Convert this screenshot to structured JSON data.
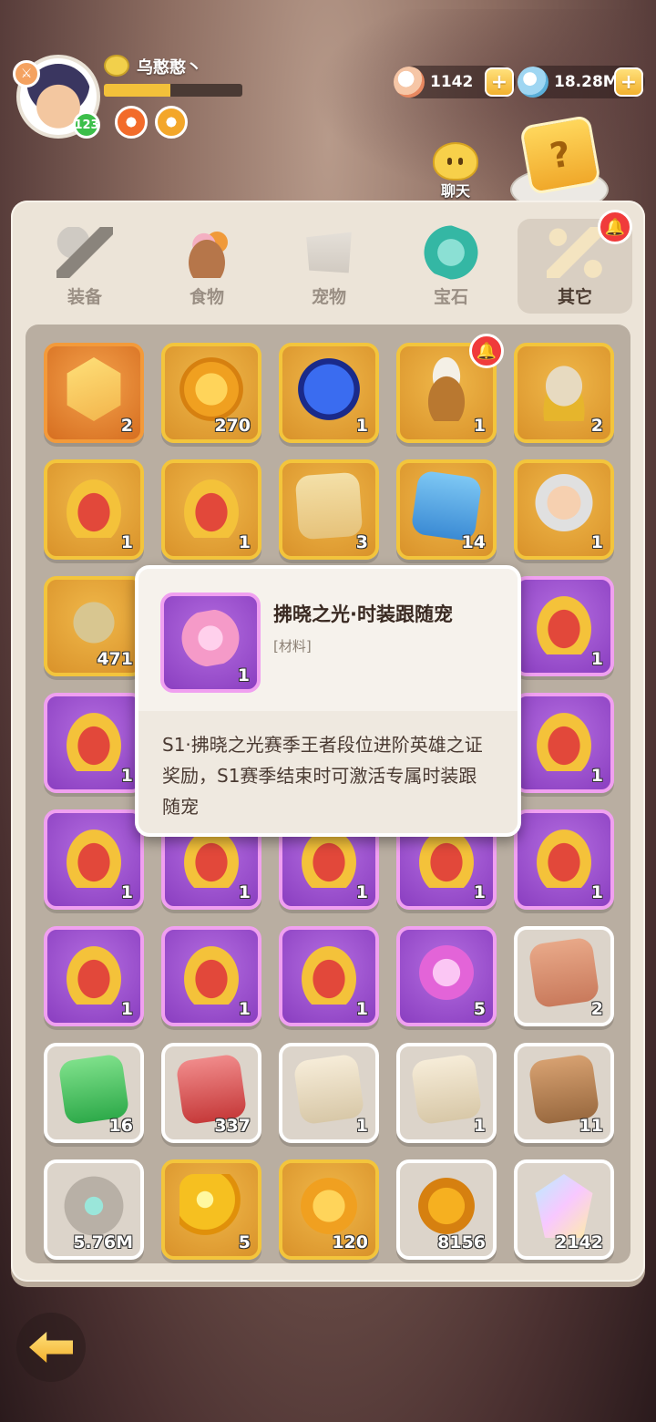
{
  "player": {
    "name": "乌憨憨丶",
    "level": "123",
    "exp_fraction": 0.48,
    "icons": [
      "sword-icon",
      "rank-smile-icon",
      "buff-fire-icon",
      "buff-swirl-icon"
    ]
  },
  "currencies": [
    {
      "name": "shell",
      "value": "1142",
      "icon": "shell-icon"
    },
    {
      "name": "diamond",
      "value": "18.28M",
      "icon": "diamond-icon"
    }
  ],
  "chat": {
    "label": "聊天"
  },
  "tabs": [
    {
      "label": "装备",
      "icon": "hammer-icon",
      "active": false
    },
    {
      "label": "食物",
      "icon": "food-icon",
      "active": false
    },
    {
      "label": "宠物",
      "icon": "pet-icon",
      "active": false
    },
    {
      "label": "宝石",
      "icon": "gem-icon",
      "active": false
    },
    {
      "label": "其它",
      "icon": "bone-icon",
      "active": true
    }
  ],
  "inventory": [
    {
      "icon": "crystal-pet-icon",
      "count": "2",
      "rarity": "orange"
    },
    {
      "icon": "spiral-coin-icon",
      "count": "270",
      "rarity": "gold"
    },
    {
      "icon": "skill-icon",
      "count": "1",
      "rarity": "gold"
    },
    {
      "icon": "horn-chest-icon",
      "count": "1",
      "rarity": "gold",
      "alert": true
    },
    {
      "icon": "egg-icon",
      "count": "2",
      "rarity": "gold"
    },
    {
      "icon": "treasure-chest-icon",
      "count": "1",
      "rarity": "gold"
    },
    {
      "icon": "treasure-chest-icon",
      "count": "1",
      "rarity": "gold"
    },
    {
      "icon": "blueprint-icon",
      "count": "3",
      "rarity": "gold"
    },
    {
      "icon": "blue-ticket-icon",
      "count": "14",
      "rarity": "gold"
    },
    {
      "icon": "hero-card-icon",
      "count": "1",
      "rarity": "gold"
    },
    {
      "icon": "statue-icon",
      "count": "471",
      "rarity": "gold"
    },
    {
      "icon": "treasure-chest-icon",
      "count": "",
      "rarity": "purple"
    },
    {
      "icon": "treasure-chest-icon",
      "count": "",
      "rarity": "purple"
    },
    {
      "icon": "treasure-chest-icon",
      "count": "",
      "rarity": "purple"
    },
    {
      "icon": "treasure-chest-icon",
      "count": "1",
      "rarity": "purple"
    },
    {
      "icon": "treasure-chest-icon",
      "count": "1",
      "rarity": "purple"
    },
    {
      "icon": "treasure-chest-icon",
      "count": "",
      "rarity": "purple"
    },
    {
      "icon": "treasure-chest-icon",
      "count": "",
      "rarity": "purple"
    },
    {
      "icon": "treasure-chest-icon",
      "count": "",
      "rarity": "purple"
    },
    {
      "icon": "treasure-chest-icon",
      "count": "1",
      "rarity": "purple"
    },
    {
      "icon": "treasure-chest-icon",
      "count": "1",
      "rarity": "purple"
    },
    {
      "icon": "treasure-chest-icon",
      "count": "1",
      "rarity": "purple"
    },
    {
      "icon": "treasure-chest-icon",
      "count": "1",
      "rarity": "purple"
    },
    {
      "icon": "treasure-chest-icon",
      "count": "1",
      "rarity": "purple"
    },
    {
      "icon": "treasure-chest-icon",
      "count": "1",
      "rarity": "purple"
    },
    {
      "icon": "treasure-chest-icon",
      "count": "1",
      "rarity": "purple"
    },
    {
      "icon": "treasure-chest-icon",
      "count": "1",
      "rarity": "purple"
    },
    {
      "icon": "treasure-chest-icon",
      "count": "1",
      "rarity": "purple"
    },
    {
      "icon": "pink-gem-icon",
      "count": "5",
      "rarity": "purple"
    },
    {
      "icon": "paw-scroll-icon",
      "count": "2",
      "rarity": "white"
    },
    {
      "icon": "green-scroll-icon",
      "count": "16",
      "rarity": "white"
    },
    {
      "icon": "red-scroll-icon",
      "count": "337",
      "rarity": "white"
    },
    {
      "icon": "beige-scroll-icon",
      "count": "1",
      "rarity": "white"
    },
    {
      "icon": "beige-scroll-icon",
      "count": "1",
      "rarity": "white"
    },
    {
      "icon": "brown-scroll-icon",
      "count": "11",
      "rarity": "white"
    },
    {
      "icon": "rune-stone-icon",
      "count": "5.76M",
      "rarity": "white"
    },
    {
      "icon": "golden-orb-icon",
      "count": "5",
      "rarity": "gold"
    },
    {
      "icon": "rune-coin-icon",
      "count": "120",
      "rarity": "gold"
    },
    {
      "icon": "char-coin-icon",
      "count": "8156",
      "rarity": "white"
    },
    {
      "icon": "rainbow-crystal-icon",
      "count": "2142",
      "rarity": "white"
    }
  ],
  "tooltip": {
    "title": "拂晓之光·时装跟随宠",
    "type": "[材料]",
    "count": "1",
    "description": "S1·拂晓之光赛季王者段位进阶英雄之证奖励，S1赛季结束时可激活专属时装跟随宠",
    "icon": "pink-costume-pet-icon"
  },
  "colors": {
    "gold_border": "#f3c53c",
    "purple_border": "#f0a0f0",
    "alert_red": "#f03b3b"
  }
}
